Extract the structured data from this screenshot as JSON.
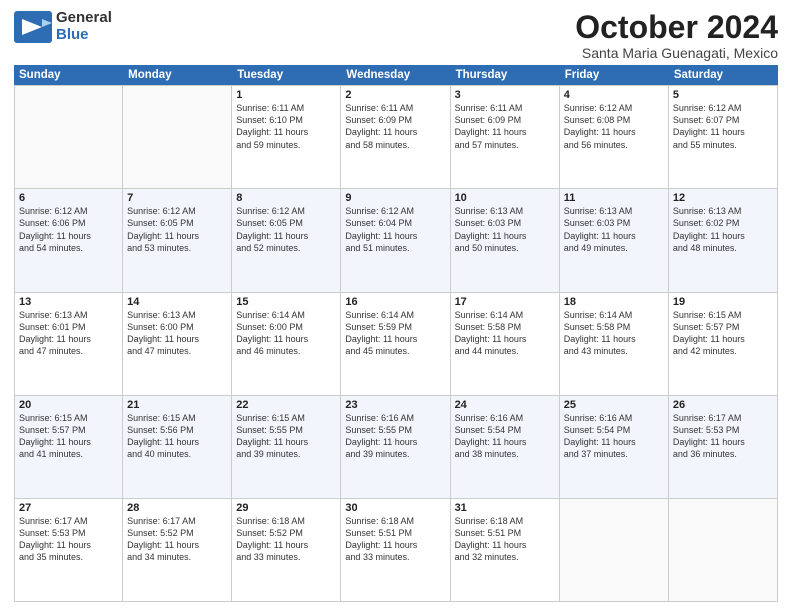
{
  "header": {
    "logo_general": "General",
    "logo_blue": "Blue",
    "title": "October 2024",
    "location": "Santa Maria Guenagati, Mexico"
  },
  "days_of_week": [
    "Sunday",
    "Monday",
    "Tuesday",
    "Wednesday",
    "Thursday",
    "Friday",
    "Saturday"
  ],
  "weeks": [
    [
      {
        "day": "",
        "empty": true,
        "lines": []
      },
      {
        "day": "",
        "empty": true,
        "lines": []
      },
      {
        "day": "1",
        "empty": false,
        "lines": [
          "Sunrise: 6:11 AM",
          "Sunset: 6:10 PM",
          "Daylight: 11 hours",
          "and 59 minutes."
        ]
      },
      {
        "day": "2",
        "empty": false,
        "lines": [
          "Sunrise: 6:11 AM",
          "Sunset: 6:09 PM",
          "Daylight: 11 hours",
          "and 58 minutes."
        ]
      },
      {
        "day": "3",
        "empty": false,
        "lines": [
          "Sunrise: 6:11 AM",
          "Sunset: 6:09 PM",
          "Daylight: 11 hours",
          "and 57 minutes."
        ]
      },
      {
        "day": "4",
        "empty": false,
        "lines": [
          "Sunrise: 6:12 AM",
          "Sunset: 6:08 PM",
          "Daylight: 11 hours",
          "and 56 minutes."
        ]
      },
      {
        "day": "5",
        "empty": false,
        "lines": [
          "Sunrise: 6:12 AM",
          "Sunset: 6:07 PM",
          "Daylight: 11 hours",
          "and 55 minutes."
        ]
      }
    ],
    [
      {
        "day": "6",
        "empty": false,
        "lines": [
          "Sunrise: 6:12 AM",
          "Sunset: 6:06 PM",
          "Daylight: 11 hours",
          "and 54 minutes."
        ]
      },
      {
        "day": "7",
        "empty": false,
        "lines": [
          "Sunrise: 6:12 AM",
          "Sunset: 6:05 PM",
          "Daylight: 11 hours",
          "and 53 minutes."
        ]
      },
      {
        "day": "8",
        "empty": false,
        "lines": [
          "Sunrise: 6:12 AM",
          "Sunset: 6:05 PM",
          "Daylight: 11 hours",
          "and 52 minutes."
        ]
      },
      {
        "day": "9",
        "empty": false,
        "lines": [
          "Sunrise: 6:12 AM",
          "Sunset: 6:04 PM",
          "Daylight: 11 hours",
          "and 51 minutes."
        ]
      },
      {
        "day": "10",
        "empty": false,
        "lines": [
          "Sunrise: 6:13 AM",
          "Sunset: 6:03 PM",
          "Daylight: 11 hours",
          "and 50 minutes."
        ]
      },
      {
        "day": "11",
        "empty": false,
        "lines": [
          "Sunrise: 6:13 AM",
          "Sunset: 6:03 PM",
          "Daylight: 11 hours",
          "and 49 minutes."
        ]
      },
      {
        "day": "12",
        "empty": false,
        "lines": [
          "Sunrise: 6:13 AM",
          "Sunset: 6:02 PM",
          "Daylight: 11 hours",
          "and 48 minutes."
        ]
      }
    ],
    [
      {
        "day": "13",
        "empty": false,
        "lines": [
          "Sunrise: 6:13 AM",
          "Sunset: 6:01 PM",
          "Daylight: 11 hours",
          "and 47 minutes."
        ]
      },
      {
        "day": "14",
        "empty": false,
        "lines": [
          "Sunrise: 6:13 AM",
          "Sunset: 6:00 PM",
          "Daylight: 11 hours",
          "and 47 minutes."
        ]
      },
      {
        "day": "15",
        "empty": false,
        "lines": [
          "Sunrise: 6:14 AM",
          "Sunset: 6:00 PM",
          "Daylight: 11 hours",
          "and 46 minutes."
        ]
      },
      {
        "day": "16",
        "empty": false,
        "lines": [
          "Sunrise: 6:14 AM",
          "Sunset: 5:59 PM",
          "Daylight: 11 hours",
          "and 45 minutes."
        ]
      },
      {
        "day": "17",
        "empty": false,
        "lines": [
          "Sunrise: 6:14 AM",
          "Sunset: 5:58 PM",
          "Daylight: 11 hours",
          "and 44 minutes."
        ]
      },
      {
        "day": "18",
        "empty": false,
        "lines": [
          "Sunrise: 6:14 AM",
          "Sunset: 5:58 PM",
          "Daylight: 11 hours",
          "and 43 minutes."
        ]
      },
      {
        "day": "19",
        "empty": false,
        "lines": [
          "Sunrise: 6:15 AM",
          "Sunset: 5:57 PM",
          "Daylight: 11 hours",
          "and 42 minutes."
        ]
      }
    ],
    [
      {
        "day": "20",
        "empty": false,
        "lines": [
          "Sunrise: 6:15 AM",
          "Sunset: 5:57 PM",
          "Daylight: 11 hours",
          "and 41 minutes."
        ]
      },
      {
        "day": "21",
        "empty": false,
        "lines": [
          "Sunrise: 6:15 AM",
          "Sunset: 5:56 PM",
          "Daylight: 11 hours",
          "and 40 minutes."
        ]
      },
      {
        "day": "22",
        "empty": false,
        "lines": [
          "Sunrise: 6:15 AM",
          "Sunset: 5:55 PM",
          "Daylight: 11 hours",
          "and 39 minutes."
        ]
      },
      {
        "day": "23",
        "empty": false,
        "lines": [
          "Sunrise: 6:16 AM",
          "Sunset: 5:55 PM",
          "Daylight: 11 hours",
          "and 39 minutes."
        ]
      },
      {
        "day": "24",
        "empty": false,
        "lines": [
          "Sunrise: 6:16 AM",
          "Sunset: 5:54 PM",
          "Daylight: 11 hours",
          "and 38 minutes."
        ]
      },
      {
        "day": "25",
        "empty": false,
        "lines": [
          "Sunrise: 6:16 AM",
          "Sunset: 5:54 PM",
          "Daylight: 11 hours",
          "and 37 minutes."
        ]
      },
      {
        "day": "26",
        "empty": false,
        "lines": [
          "Sunrise: 6:17 AM",
          "Sunset: 5:53 PM",
          "Daylight: 11 hours",
          "and 36 minutes."
        ]
      }
    ],
    [
      {
        "day": "27",
        "empty": false,
        "lines": [
          "Sunrise: 6:17 AM",
          "Sunset: 5:53 PM",
          "Daylight: 11 hours",
          "and 35 minutes."
        ]
      },
      {
        "day": "28",
        "empty": false,
        "lines": [
          "Sunrise: 6:17 AM",
          "Sunset: 5:52 PM",
          "Daylight: 11 hours",
          "and 34 minutes."
        ]
      },
      {
        "day": "29",
        "empty": false,
        "lines": [
          "Sunrise: 6:18 AM",
          "Sunset: 5:52 PM",
          "Daylight: 11 hours",
          "and 33 minutes."
        ]
      },
      {
        "day": "30",
        "empty": false,
        "lines": [
          "Sunrise: 6:18 AM",
          "Sunset: 5:51 PM",
          "Daylight: 11 hours",
          "and 33 minutes."
        ]
      },
      {
        "day": "31",
        "empty": false,
        "lines": [
          "Sunrise: 6:18 AM",
          "Sunset: 5:51 PM",
          "Daylight: 11 hours",
          "and 32 minutes."
        ]
      },
      {
        "day": "",
        "empty": true,
        "lines": []
      },
      {
        "day": "",
        "empty": true,
        "lines": []
      }
    ]
  ]
}
